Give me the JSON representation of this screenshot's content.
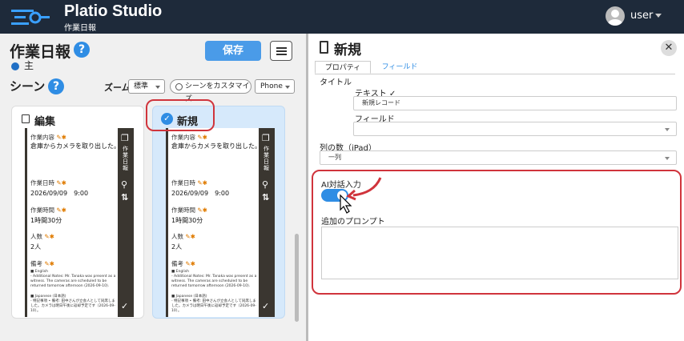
{
  "app": {
    "title": "Platio Studio",
    "subtitle": "作業日報",
    "user": "user"
  },
  "left": {
    "title": "作業日報",
    "help": "?",
    "main_label": "主",
    "save": "保存",
    "scene": "シーン",
    "zoom_label": "ズーム",
    "zoom_value": "標準",
    "customize": "シーンをカスタマイズ",
    "device": "Phone",
    "cards": [
      {
        "title": "編集"
      },
      {
        "title": "新規"
      }
    ],
    "preview": {
      "fields": [
        {
          "label": "作業内容",
          "value": "倉庫からカメラを取り出した。"
        },
        {
          "label": "作業日時",
          "value": "2026/09/09　9:00"
        },
        {
          "label": "作業時間",
          "value": "1時間30分"
        },
        {
          "label": "人数",
          "value": "2人"
        },
        {
          "label": "備考",
          "value": ""
        }
      ],
      "note_en_head": "■ English",
      "note_en": "- Additional Notes: Mr. Tanaka was present as a witness. The cameras are scheduled to be returned tomorrow afternoon (2026-09-10).",
      "note_ja_head": "■ Japanese (日本語)",
      "note_ja": "- 特記事項 • 備考: 田中さんが立会人として同席しました。カメラは明日午後に返却予定です（2026-09-10）。",
      "side_text": "作業日報"
    }
  },
  "panel": {
    "title": "新規",
    "tabs": [
      "プロパティ",
      "フィールド"
    ],
    "title_label": "タイトル",
    "text_label": "テキスト",
    "text_value": "新規レコード",
    "field_label": "フィールド",
    "field_value": "",
    "columns_label": "列の数（iPad）",
    "columns_value": "一列",
    "ai_label": "AI対話入力",
    "ai_enabled": true,
    "prompt_label": "追加のプロンプト",
    "prompt_value": ""
  },
  "colors": {
    "header": "#1e2a3a",
    "accent": "#2f8de4",
    "highlight": "#d0343c",
    "selected_card": "#d6e9fb"
  }
}
